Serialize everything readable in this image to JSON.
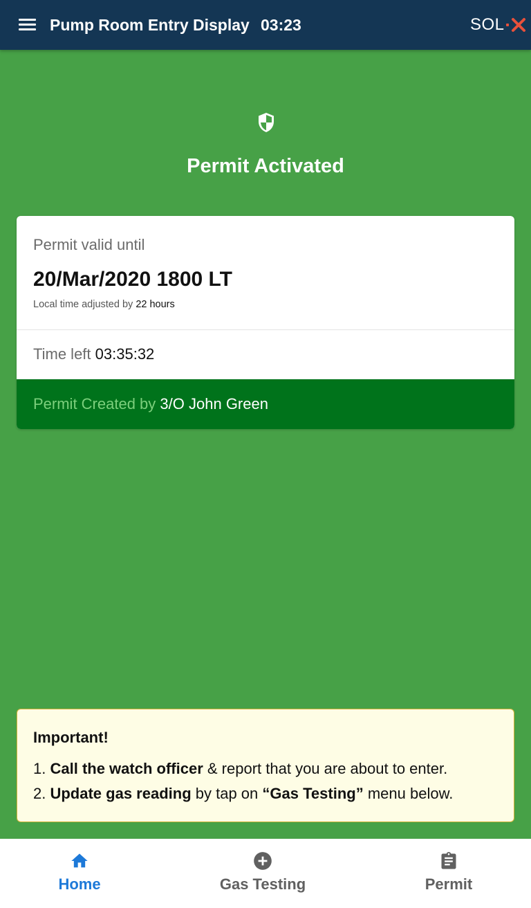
{
  "app_bar": {
    "title": "Pump Room Entry Display",
    "time": "03:23",
    "logo_text": "SOL",
    "menu_icon": "hamburger-menu-icon",
    "background": "#143654"
  },
  "status": {
    "icon": "shield-icon",
    "title": "Permit Activated",
    "background": "#47a147"
  },
  "permit_card": {
    "valid_until_label": "Permit valid until",
    "valid_until_value": "20/Mar/2020 1800 LT",
    "adjusted_prefix": "Local time adjusted by",
    "adjusted_value": "22 hours",
    "time_left_label": "Time left",
    "time_left_value": "03:35:32",
    "created_by_label": "Permit Created by",
    "created_by_value": "3/O John Green",
    "created_bar_color": "#00731b"
  },
  "notice": {
    "title": "Important!",
    "item1_number": "1.",
    "item1_bold": "Call the watch officer",
    "item1_rest": "& report that you are about to enter.",
    "item2_number": "2.",
    "item2_bold": "Update gas reading",
    "item2_mid": "by tap on",
    "item2_quote": "“Gas Testing”",
    "item2_rest": "menu below."
  },
  "bottom_nav": {
    "items": [
      {
        "label": "Home",
        "icon": "home-icon",
        "active": true
      },
      {
        "label": "Gas Testing",
        "icon": "plus-circle-icon",
        "active": false
      },
      {
        "label": "Permit",
        "icon": "clipboard-icon",
        "active": false
      }
    ],
    "active_color": "#1d79d8",
    "inactive_color": "#606060"
  }
}
